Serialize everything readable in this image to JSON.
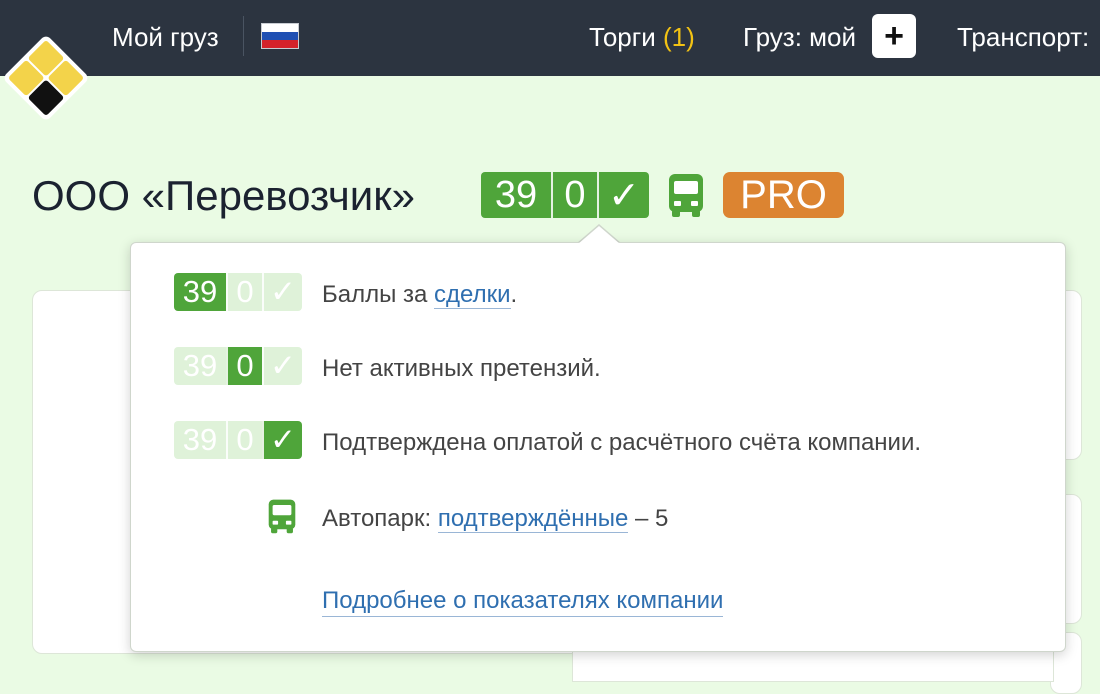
{
  "colors": {
    "topbar": "#2c3440",
    "accent_green": "#4fa53a",
    "pro_orange": "#dc8431",
    "highlight_yellow": "#f2c214",
    "link_blue": "#2f6fb0"
  },
  "header": {
    "my_cargo": "Мой груз",
    "flag_icon": "russia-flag-icon",
    "torgi_label": "Торги",
    "torgi_count": "(1)",
    "cargo_my": "Груз: мой",
    "plus_label": "+",
    "transport": "Транспорт:"
  },
  "company": {
    "name": "ООО «Перевозчик»",
    "score": "39",
    "claims": "0",
    "verified_mark": "✓",
    "fleet_icon": "bus-icon",
    "pro": "PRO"
  },
  "popover": {
    "rows": [
      {
        "score": "39",
        "claims": "0",
        "check": "✓",
        "active": "score",
        "prefix": "Баллы за ",
        "link": "сделки",
        "suffix": "."
      },
      {
        "score": "39",
        "claims": "0",
        "check": "✓",
        "active": "claims",
        "text": "Нет активных претензий."
      },
      {
        "score": "39",
        "claims": "0",
        "check": "✓",
        "active": "check",
        "text": "Подтверждена оплатой с расчётного счёта компании."
      }
    ],
    "fleet": {
      "prefix": "Автопарк: ",
      "link": "подтверждённые",
      "suffix": " – 5"
    },
    "more_link": "Подробнее о показателях компании"
  }
}
